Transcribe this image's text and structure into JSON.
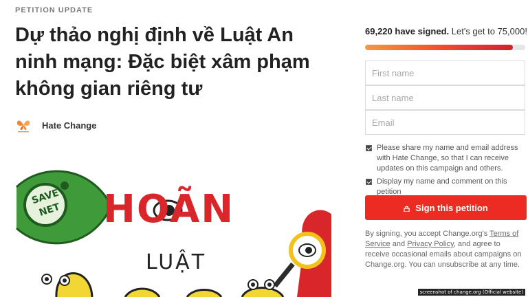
{
  "article": {
    "eyebrow": "PETITION UPDATE",
    "headline": "Dự thảo nghị định về Luật An ninh mạng: Đặc biệt xâm phạm không gian riêng tư",
    "author": {
      "name": "Hate Change",
      "logo_icon": "orange-butterfly-logo"
    },
    "image": {
      "badge_text": "SAVE NET",
      "text_line1": "HOÃN",
      "text_line2": "LUẬT"
    }
  },
  "signature": {
    "signed_count": "69,220 have signed.",
    "goal_text": "Let's get to 75,000!",
    "progress_fraction": 0.923,
    "form": {
      "first_name_placeholder": "First name",
      "last_name_placeholder": "Last name",
      "email_placeholder": "Email"
    },
    "consent_share": "Please share my name and email address with Hate Change, so that I can receive updates on this campaign and others.",
    "consent_display": "Display my name and comment on this petition",
    "button_label": "Sign this petition",
    "button_icon": "lock-icon",
    "legal": {
      "prefix": "By signing, you accept Change.org's ",
      "terms": "Terms of Service",
      "middle": " and ",
      "privacy": "Privacy Policy",
      "suffix": ", and agree to receive occasional emails about campaigns on Change.org. You can unsubscribe at any time."
    }
  },
  "watermark": "screenshot of change.org (Official website)",
  "colors": {
    "accent": "#ec2c22",
    "progress_start": "#f29a3f",
    "progress_end": "#d91f2a"
  }
}
